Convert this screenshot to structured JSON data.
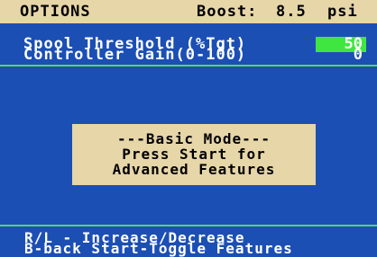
{
  "header": {
    "title": "OPTIONS",
    "boost_label": "Boost:",
    "boost_value": "8.5",
    "boost_unit": "psi"
  },
  "params": [
    {
      "label": "Spool Threshold (%Tgt)",
      "value": "50",
      "selected": true
    },
    {
      "label": "Controller Gain(0-100)",
      "value": "0",
      "selected": false
    }
  ],
  "mode_box": {
    "line1": "---Basic  Mode---",
    "line2": "Press Start for",
    "line3": "Advanced Features"
  },
  "help": {
    "line1": "R/L - Increase/Decrease",
    "line2": "B-back  Start-Toggle Features"
  },
  "colors": {
    "background": "#1c4fb4",
    "banner": "#e6d6a8",
    "highlight": "#40e640",
    "rule": "#59d859"
  }
}
